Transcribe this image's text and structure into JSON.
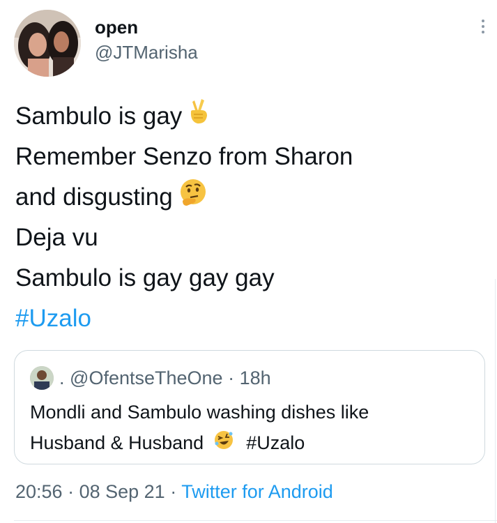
{
  "tweet": {
    "display_name": "open",
    "handle": "@JTMarisha",
    "lines": [
      "Sambulo is gay",
      "Remember Senzo from Sharon",
      "and disgusting",
      "Deja vu",
      "Sambulo is gay gay gay"
    ],
    "hashtag": "#Uzalo",
    "emojis": {
      "crossed_fingers": "crossed-fingers-icon",
      "thinking_face": "thinking-face-icon"
    }
  },
  "quote": {
    "separator": ".",
    "handle": "@OfentseTheOne",
    "time": "· 18h",
    "line1": "Mondli and Sambulo washing dishes like",
    "line2_text": "Husband & Husband",
    "line2_hashtag": "#Uzalo",
    "emoji": "rolling-laughing-icon"
  },
  "footer": {
    "time": "20:56",
    "date": "· 08 Sep 21 ·",
    "source": "Twitter for Android"
  },
  "colors": {
    "link": "#1d9bf0",
    "muted": "#536471",
    "text": "#0f1419",
    "border": "#cfd9de"
  }
}
